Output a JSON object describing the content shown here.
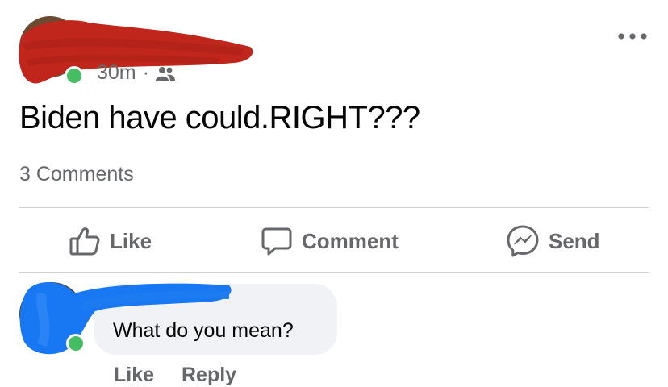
{
  "post": {
    "timestamp": "30m",
    "separator": "·",
    "audience_icon": "friends-icon",
    "text": "Biden have could.RIGHT???",
    "comments_count": "3 Comments"
  },
  "actions": {
    "like_label": "Like",
    "comment_label": "Comment",
    "send_label": "Send"
  },
  "comment": {
    "text": "What do you mean?",
    "like_label": "Like",
    "reply_label": "Reply"
  },
  "colors": {
    "redaction_red": "#c0261b",
    "redaction_blue": "#1877f2",
    "online": "#45bd62",
    "muted_text": "#65676b",
    "bubble": "#f0f2f5"
  }
}
